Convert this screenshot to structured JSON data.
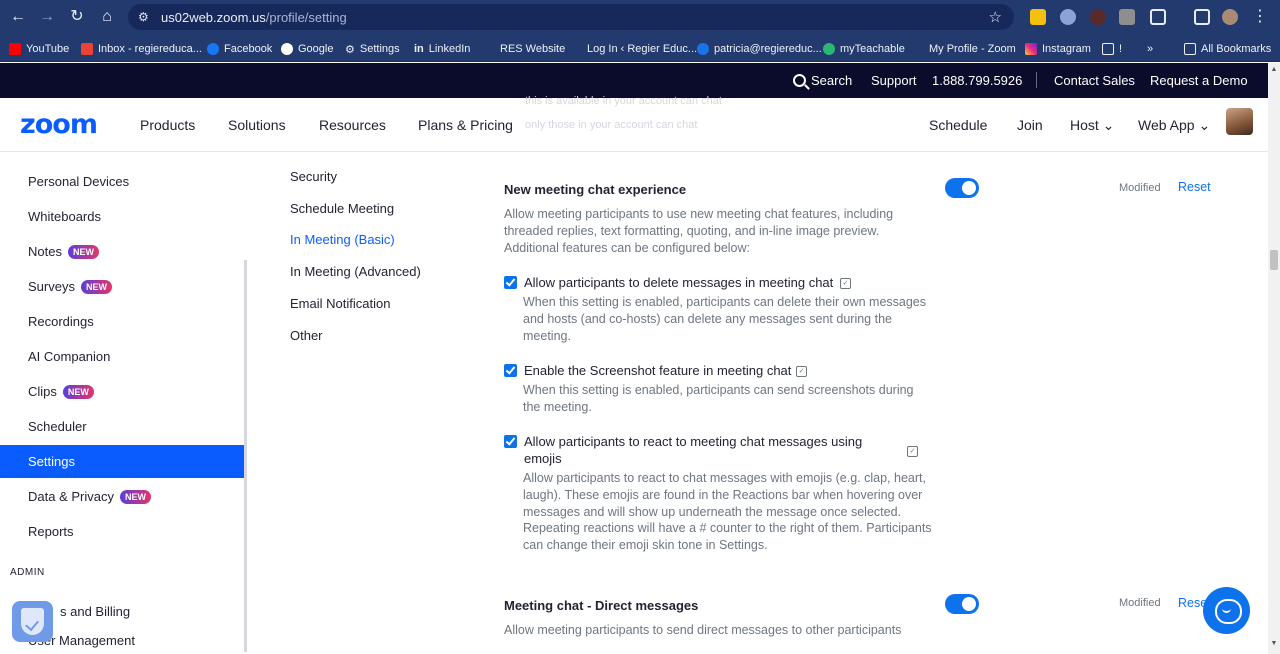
{
  "browser": {
    "url_host": "us02web.zoom.us",
    "url_path": "/profile/setting",
    "bookmarks": [
      {
        "label": "YouTube"
      },
      {
        "label": "Inbox - regiereduca..."
      },
      {
        "label": "Facebook"
      },
      {
        "label": "Google"
      },
      {
        "label": "Settings"
      },
      {
        "label": "LinkedIn"
      },
      {
        "label": "RES Website"
      },
      {
        "label": "Log In ‹ Regier Educ..."
      },
      {
        "label": "patricia@regiereduc..."
      },
      {
        "label": "myTeachable"
      },
      {
        "label": "My Profile - Zoom"
      },
      {
        "label": "Instagram"
      },
      {
        "label": "!"
      },
      {
        "label": "»"
      },
      {
        "label": "All Bookmarks"
      }
    ]
  },
  "topbar": {
    "search": "Search",
    "support": "Support",
    "phone": "1.888.799.5926",
    "contact_sales": "Contact Sales",
    "request_demo": "Request a Demo"
  },
  "header": {
    "logo": "zoom",
    "nav": [
      "Products",
      "Solutions",
      "Resources",
      "Plans & Pricing"
    ],
    "right": [
      "Schedule",
      "Join",
      "Host ⌄",
      "Web App ⌄"
    ],
    "ghost_line_1": "this is available in your account can chat",
    "ghost_line_2": "only those in your account can chat"
  },
  "sidebar": {
    "items": [
      {
        "label": "Personal Devices",
        "badge": ""
      },
      {
        "label": "Whiteboards",
        "badge": ""
      },
      {
        "label": "Notes",
        "badge": "NEW"
      },
      {
        "label": "Surveys",
        "badge": "NEW"
      },
      {
        "label": "Recordings",
        "badge": ""
      },
      {
        "label": "AI Companion",
        "badge": ""
      },
      {
        "label": "Clips",
        "badge": "NEW"
      },
      {
        "label": "Scheduler",
        "badge": ""
      },
      {
        "label": "Settings",
        "badge": ""
      },
      {
        "label": "Data & Privacy",
        "badge": "NEW"
      },
      {
        "label": "Reports",
        "badge": ""
      }
    ],
    "admin_label": "ADMIN",
    "admin_items": [
      {
        "label": "s and Billing"
      },
      {
        "label": "User Management"
      }
    ],
    "active_item": "Settings"
  },
  "subnav": {
    "items": [
      "Security",
      "Schedule Meeting",
      "In Meeting (Basic)",
      "In Meeting (Advanced)",
      "Email Notification",
      "Other"
    ],
    "active": "In Meeting (Basic)"
  },
  "settings": {
    "new_chat": {
      "title": "New meeting chat experience",
      "desc_lines": [
        "Allow meeting participants to use new meeting chat features, including",
        "threaded replies, text formatting, quoting, and in-line image preview.",
        "Additional features can be configured below:"
      ],
      "enabled": true,
      "modified": "Modified",
      "reset": "Reset",
      "options": [
        {
          "label_lines": [
            "Allow participants to delete messages in meeting chat"
          ],
          "checked": true,
          "desc_lines": [
            "When this setting is enabled, participants can delete their own messages",
            "and hosts (and co-hosts) can delete any messages sent during the",
            "meeting."
          ]
        },
        {
          "label_lines": [
            "Enable the Screenshot feature in meeting chat"
          ],
          "checked": true,
          "desc_lines": [
            "When this setting is enabled, participants can send screenshots during",
            "the meeting."
          ]
        },
        {
          "label_lines": [
            "Allow participants to react to meeting chat messages using",
            "emojis"
          ],
          "checked": true,
          "desc_lines": [
            "Allow participants to react to chat messages with emojis (e.g. clap, heart,",
            "laugh). These emojis are found in the Reactions bar when hovering over",
            "messages and will show up underneath the message once selected.",
            "Repeating reactions will have a # counter to the right of them. Participants",
            "can change their emoji skin tone in Settings."
          ]
        }
      ]
    },
    "direct_messages": {
      "title": "Meeting chat - Direct messages",
      "desc": "Allow meeting participants to send direct messages to other participants",
      "enabled": true,
      "modified": "Modified",
      "reset": "Rese"
    }
  },
  "colors": {
    "accent": "#0b5cff",
    "toggle": "#0e72ed",
    "topbar": "#0b0b2b",
    "browser": "#233a6e"
  }
}
